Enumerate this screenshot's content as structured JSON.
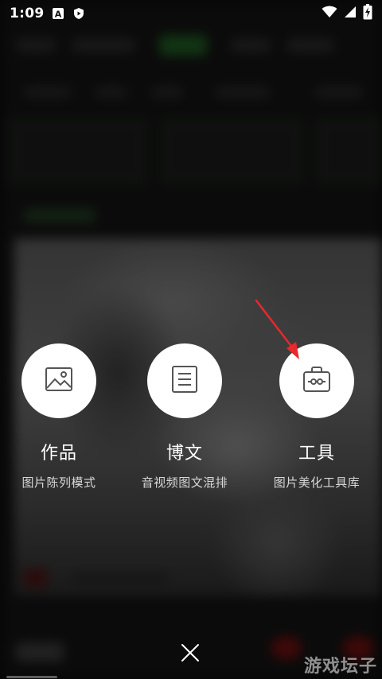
{
  "status_bar": {
    "time": "1:09",
    "left_icons": [
      "a-badge-icon",
      "shield-play-icon"
    ],
    "right_icons": [
      "wifi-icon",
      "signal-icon",
      "battery-charging-icon"
    ]
  },
  "menu": {
    "options": [
      {
        "icon": "image-icon",
        "title": "作品",
        "subtitle": "图片陈列模式"
      },
      {
        "icon": "article-icon",
        "title": "博文",
        "subtitle": "音视频图文混排"
      },
      {
        "icon": "toolbox-icon",
        "title": "工具",
        "subtitle": "图片美化工具库"
      }
    ]
  },
  "bottom_bar": {
    "close_icon": "close-icon"
  },
  "watermark": {
    "text": "游戏坛子"
  },
  "colors": {
    "overlay": "#000000",
    "circle": "#ffffff",
    "icon_stroke": "#555555",
    "arrow": "#e8282b"
  }
}
